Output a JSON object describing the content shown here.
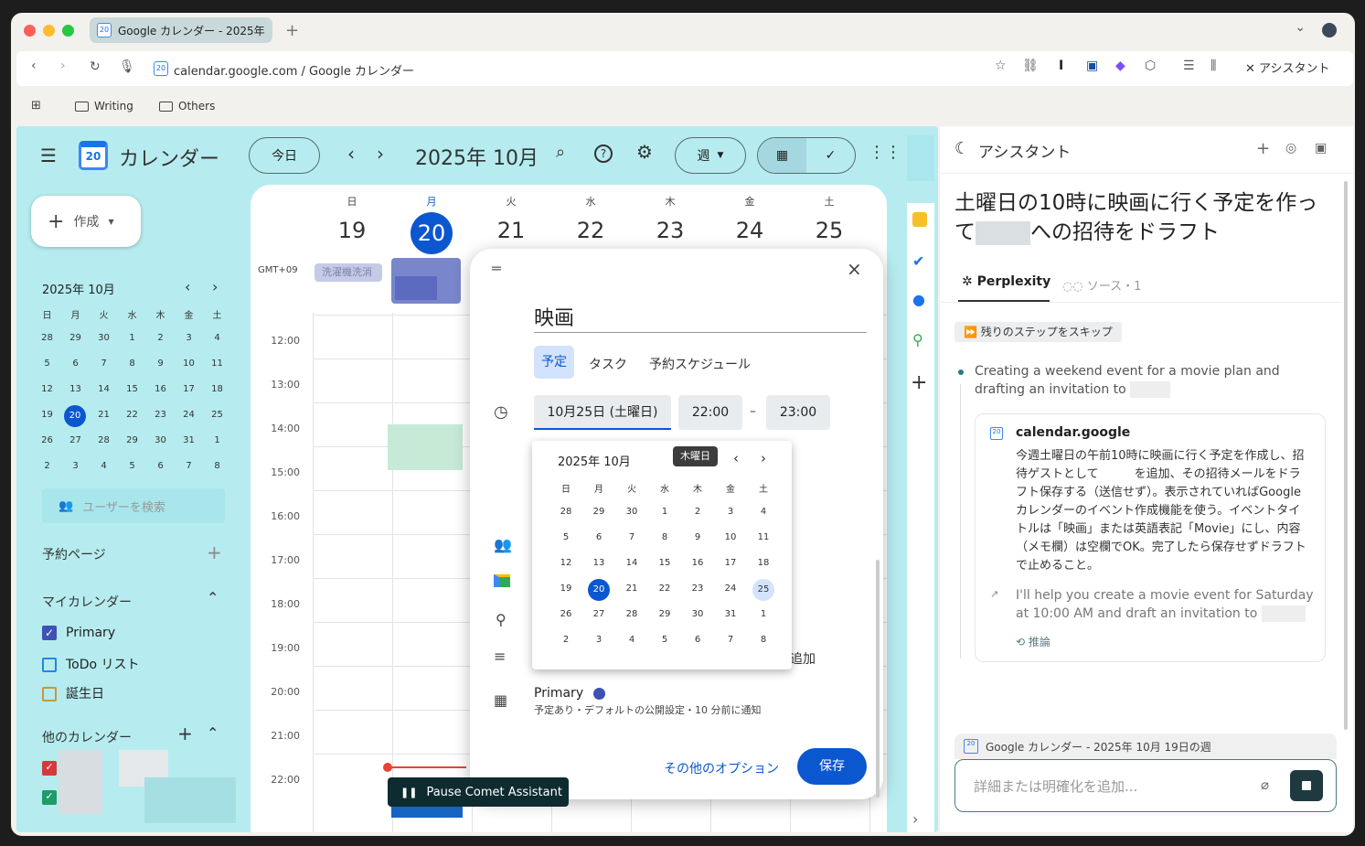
{
  "browser": {
    "tab_title": "Google カレンダー - 2025年",
    "favicon_text": "20",
    "url": "calendar.google.com / Google カレンダー",
    "assistant_button": "アシスタント",
    "bookmarks": [
      "Writing",
      "Others"
    ]
  },
  "calendar": {
    "app_name": "カレンダー",
    "today_button": "今日",
    "month_title": "2025年 10月",
    "view_select": "週",
    "create_button": "作成",
    "timezone": "GMT+09",
    "weekdays": [
      "日",
      "月",
      "火",
      "水",
      "木",
      "金",
      "土"
    ],
    "week_dates": [
      "19",
      "20",
      "21",
      "22",
      "23",
      "24",
      "25"
    ],
    "allday_event": "洗濯機洗消",
    "hours": [
      "12:00",
      "13:00",
      "14:00",
      "15:00",
      "16:00",
      "17:00",
      "18:00",
      "19:00",
      "20:00",
      "21:00",
      "22:00"
    ],
    "mini_cal": {
      "title": "2025年 10月",
      "rows": [
        [
          "28",
          "29",
          "30",
          "1",
          "2",
          "3",
          "4"
        ],
        [
          "5",
          "6",
          "7",
          "8",
          "9",
          "10",
          "11"
        ],
        [
          "12",
          "13",
          "14",
          "15",
          "16",
          "17",
          "18"
        ],
        [
          "19",
          "20",
          "21",
          "22",
          "23",
          "24",
          "25"
        ],
        [
          "26",
          "27",
          "28",
          "29",
          "30",
          "31",
          "1"
        ],
        [
          "2",
          "3",
          "4",
          "5",
          "6",
          "7",
          "8"
        ]
      ]
    },
    "search_users": "ユーザーを検索",
    "booking_pages": "予約ページ",
    "my_calendars_label": "マイカレンダー",
    "my_calendars": [
      {
        "name": "Primary",
        "color": "#3f51b5",
        "checked": true
      },
      {
        "name": "ToDo リスト",
        "color": "#1e88e5",
        "checked": false
      },
      {
        "name": "誕生日",
        "color": "#c49a3a",
        "checked": false
      }
    ],
    "other_calendars_label": "他のカレンダー"
  },
  "event_modal": {
    "title": "映画",
    "tabs": [
      "予定",
      "タスク",
      "予約スケジュール"
    ],
    "date": "10月25日 (土曜日)",
    "start_time": "22:00",
    "dash": "–",
    "end_time": "23:00",
    "datepicker_title": "2025年 10月",
    "tooltip": "木曜日",
    "partial_text": "追加",
    "calendar_name": "Primary",
    "calendar_sub": "予定あり・デフォルトの公開設定・10 分前に通知",
    "more_options": "その他のオプション",
    "save": "保存"
  },
  "comet_pause": "Pause Comet Assistant",
  "assistant": {
    "header": "アシスタント",
    "query_part1": "土曜日の10時に映画に行く予定を作って",
    "query_part2": "への招待をドラフト",
    "tab_perplexity": "Perplexity",
    "tab_sources": "ソース・1",
    "skip_steps": "残りのステップをスキップ",
    "step_text": "Creating a weekend event for a movie plan and drafting an invitation to",
    "card_title": "calendar.google",
    "card_body": "今週土曜日の午前10時に映画に行く予定を作成し、招待ゲストとして　　　を追加、その招待メールをドラフト保存する（送信せず）。表示されていればGoogleカレンダーのイベント作成機能を使う。イベントタイトルは「映画」または英語表記「Movie」にし、内容（メモ欄）は空欄でOK。完了したら保存せずドラフトで止めること。",
    "card_reply": "I'll help you create a movie event for Saturday at 10:00 AM and draft an invitation to",
    "reasoning": "推論",
    "context_chip": "Google カレンダー - 2025年 10月 19日の週",
    "input_placeholder": "詳細または明確化を追加..."
  },
  "colors": {
    "accent": "#0b57d0",
    "page_bg": "#b6ecef",
    "today": "#0b57d0"
  }
}
